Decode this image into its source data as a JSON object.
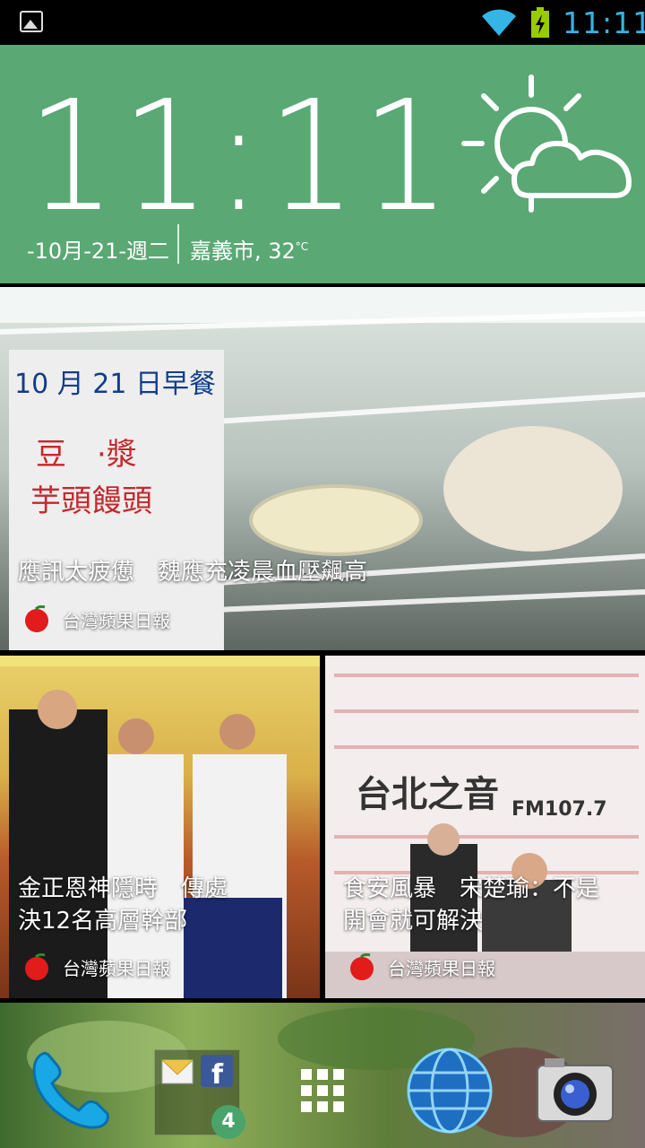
{
  "status_bar": {
    "time": "11:11",
    "notification_icon": "image-icon",
    "wifi_icon": "wifi-icon",
    "battery_icon": "battery-charging-icon",
    "accent": "#33b5e5"
  },
  "clock_widget": {
    "time": "11:11",
    "date": "-10月-21-週二",
    "location": "嘉義市, 32",
    "unit": "°C",
    "weather_icon": "sun-cloud-icon",
    "background": "#5aa874"
  },
  "news": [
    {
      "headline": "應訊太疲憊　魏應充凌晨血壓飆高",
      "source": "台灣蘋果日報"
    },
    {
      "headline_line1": "金正恩神隱時　傳處",
      "headline_line2": "決12名高層幹部",
      "source": "台灣蘋果日報"
    },
    {
      "headline_line1": "食安風暴　宋楚瑜：不是",
      "headline_line2": "開會就可解決",
      "source": "台灣蘋果日報"
    }
  ],
  "photo_text": {
    "sign_line1": "10 月 21 日早餐",
    "sign_line2": "豆　·漿",
    "sign_line3": "芋頭饅頭",
    "station": "台北之音",
    "frequency": "FM107.7"
  },
  "dock": {
    "phone_icon": "phone-icon",
    "folder_icons": [
      "email-icon",
      "facebook-icon"
    ],
    "folder_badge": "4",
    "apps_icon": "app-drawer-icon",
    "browser_icon": "globe-icon",
    "camera_icon": "camera-icon"
  }
}
